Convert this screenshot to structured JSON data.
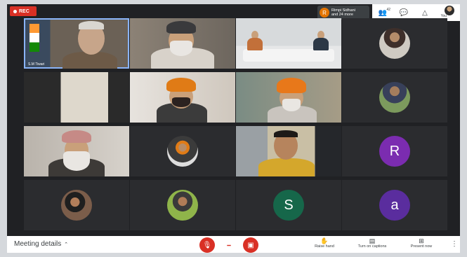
{
  "top_bar": {
    "rec_label": "REC",
    "presenter": {
      "avatar_letter": "R",
      "line1": "Rimpi Sidhani",
      "line2": "and 24 more"
    },
    "participants_count": "42",
    "self_label": "You"
  },
  "tiles": [
    {
      "name": "S.M Tiwari"
    },
    {
      "avatar_letter_r": "R"
    },
    {
      "avatar_letter_s": "S"
    },
    {
      "avatar_letter_a": "a"
    }
  ],
  "colors": {
    "avatar_r": "#7b2cb0",
    "avatar_s": "#16674a",
    "avatar_a": "#5a2d9e",
    "accent": "#8ab4f8",
    "danger": "#d93025"
  },
  "bottom_bar": {
    "meeting_details": "Meeting details",
    "raise_hand": "Raise hand",
    "turn_on_captions": "Turn on captions",
    "present_now": "Present now"
  }
}
